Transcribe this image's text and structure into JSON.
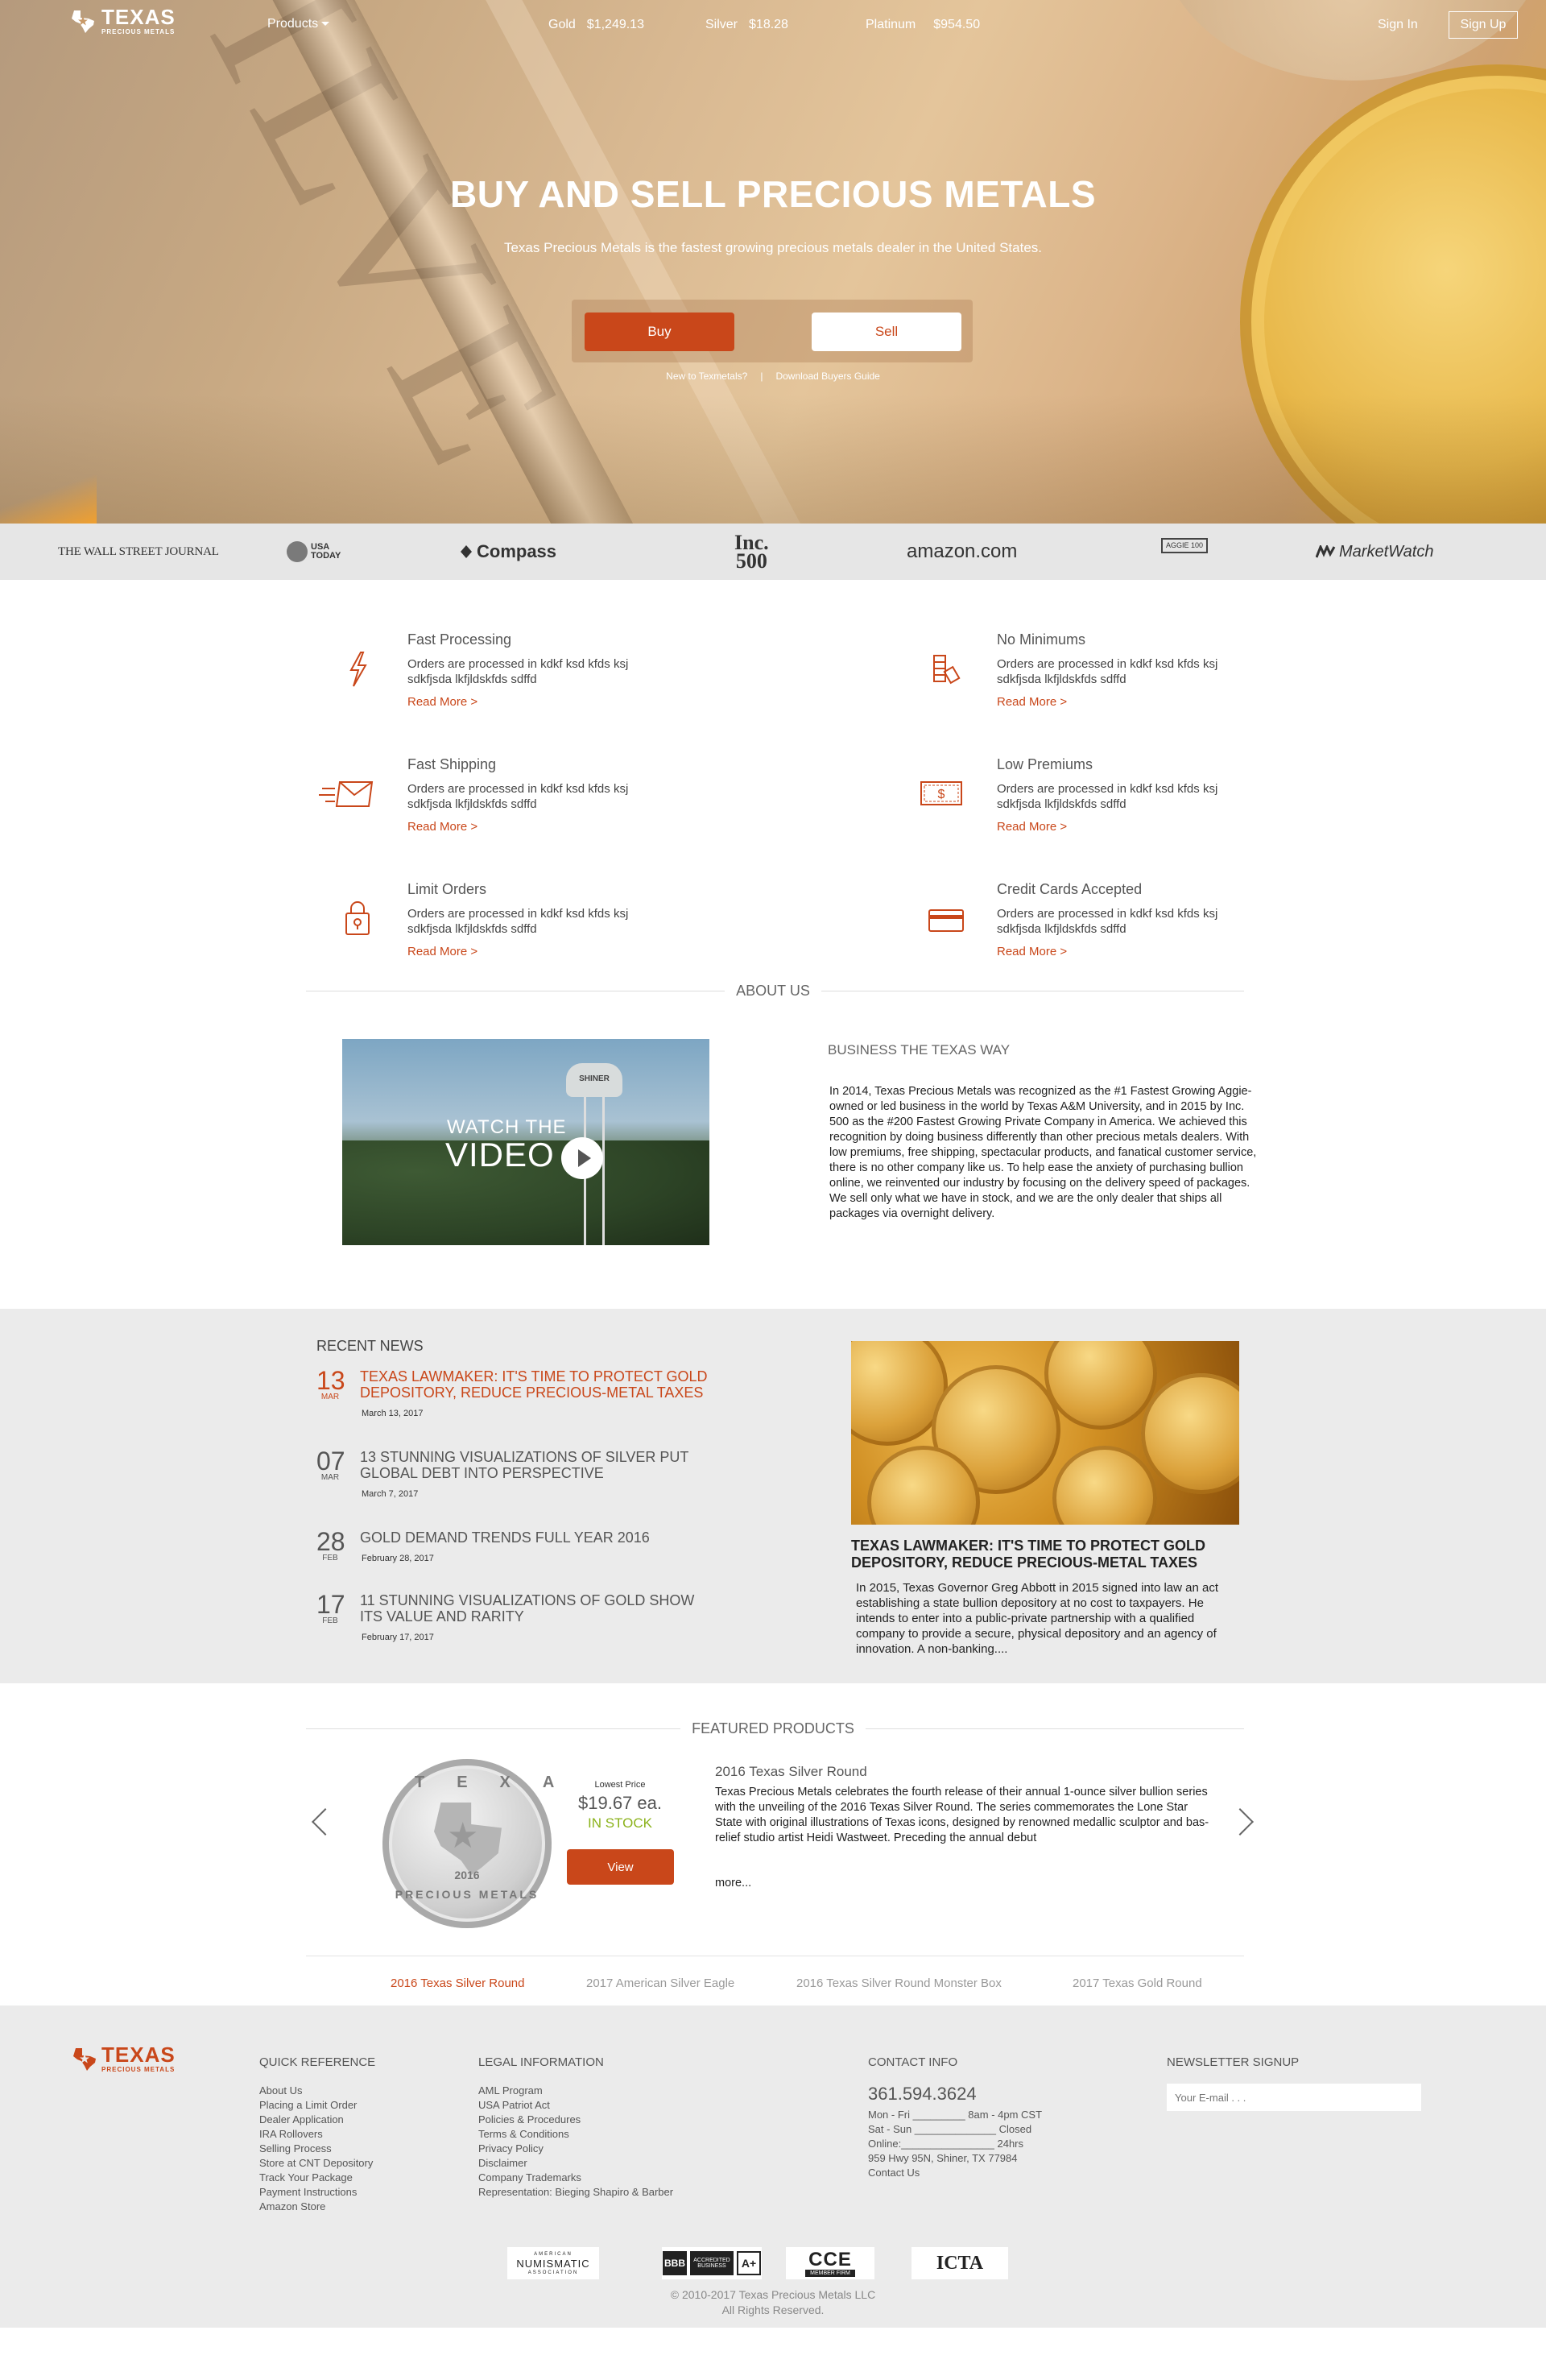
{
  "header": {
    "logo_main": "TEXAS",
    "logo_sub": "PRECIOUS METALS",
    "products_label": "Products",
    "spot_prices": [
      {
        "name": "Gold",
        "price": "$1,249.13"
      },
      {
        "name": "Silver",
        "price": "$18.28"
      },
      {
        "name": "Platinum",
        "price": "$954.50"
      }
    ],
    "sign_in": "Sign In",
    "sign_up": "Sign Up"
  },
  "hero": {
    "title": "BUY AND SELL PRECIOUS METALS",
    "subtitle": "Texas Precious Metals is the fastest growing precious metals dealer in the United States.",
    "buy_label": "Buy",
    "sell_label": "Sell",
    "link_new": "New to Texmetals?",
    "link_separator": "|",
    "link_guide": "Download Buyers Guide",
    "stamp_text": "SILVE"
  },
  "press": {
    "wsj": "THE WALL STREET JOURNAL",
    "usa_today": "USA TODAY",
    "compass": "Compass",
    "inc_top": "Inc.",
    "inc_bottom": "500",
    "amazon": "amazon.com",
    "aggie": "AGGIE 100",
    "marketwatch": "MarketWatch"
  },
  "features": [
    {
      "title": "Fast Processing",
      "text": "Orders are processed in kdkf ksd kfds ksj sdkfjsda lkfjldskfds sdffd",
      "link": "Read More >",
      "icon": "lightning-icon"
    },
    {
      "title": "No Minimums",
      "text": "Orders are processed in kdkf ksd kfds ksj sdkfjsda lkfjldskfds sdffd",
      "link": "Read More >",
      "icon": "bars-stack-icon"
    },
    {
      "title": "Fast Shipping",
      "text": "Orders are processed in kdkf ksd kfds ksj sdkfjsda lkfjldskfds sdffd",
      "link": "Read More >",
      "icon": "envelope-icon"
    },
    {
      "title": "Low Premiums",
      "text": "Orders are processed in kdkf ksd kfds ksj sdkfjsda lkfjldskfds sdffd",
      "link": "Read More >",
      "icon": "dollar-bill-icon"
    },
    {
      "title": "Limit Orders",
      "text": "Orders are processed in kdkf ksd kfds ksj sdkfjsda lkfjldskfds sdffd",
      "link": "Read More >",
      "icon": "lock-icon"
    },
    {
      "title": "Credit Cards Accepted",
      "text": "Orders are processed in kdkf ksd kfds ksj sdkfjsda lkfjldskfds sdffd",
      "link": "Read More >",
      "icon": "credit-card-icon"
    }
  ],
  "about": {
    "heading": "ABOUT US",
    "video_line1": "WATCH THE",
    "video_line2": "VIDEO",
    "video_tower_text": "SHINER",
    "title": "BUSINESS THE TEXAS WAY",
    "body": "In 2014, Texas Precious Metals was recognized as the #1 Fastest Growing Aggie-owned or led business in the world by Texas A&M University, and in 2015 by Inc. 500 as the #200 Fastest Growing Private Company in America. We achieved this recognition by doing business differently than other precious metals dealers. With low premiums, free shipping, spectacular products, and fanatical customer service, there is no other company like us. To help ease the anxiety of purchasing bullion online, we reinvented our industry by focusing on the delivery speed of packages. We sell only what we have in stock, and we are the only dealer that ships all packages via overnight delivery."
  },
  "news": {
    "heading": "RECENT NEWS",
    "items": [
      {
        "day": "13",
        "month": "MAR",
        "title": "TEXAS LAWMAKER: IT'S TIME TO PROTECT GOLD DEPOSITORY, REDUCE PRECIOUS-METAL TAXES",
        "date": "March 13, 2017"
      },
      {
        "day": "07",
        "month": "MAR",
        "title": "13 STUNNING VISUALIZATIONS OF SILVER PUT GLOBAL DEBT INTO PERSPECTIVE",
        "date": "March 7, 2017"
      },
      {
        "day": "28",
        "month": "FEB",
        "title": "GOLD DEMAND TRENDS FULL YEAR 2016",
        "date": "February 28, 2017"
      },
      {
        "day": "17",
        "month": "FEB",
        "title": "11 STUNNING VISUALIZATIONS OF GOLD SHOW ITS VALUE AND RARITY",
        "date": "February 17, 2017"
      }
    ],
    "featured_title": "TEXAS LAWMAKER: IT'S TIME TO PROTECT GOLD DEPOSITORY, REDUCE PRECIOUS-METAL TAXES",
    "featured_body": "In 2015, Texas Governor Greg Abbott in 2015 signed into law an act establishing a state bullion depository at no cost to taxpayers. He intends to enter into a public-private partnership with a qualified company to provide a secure, physical depository and an agency of innovation. A non-banking...."
  },
  "featured_products": {
    "heading": "FEATURED PRODUCTS",
    "lowest_price_label": "Lowest Price",
    "price": "$19.67 ea.",
    "stock": "IN STOCK",
    "view_label": "View",
    "product_title": "2016 Texas Silver Round",
    "product_desc": "Texas Precious Metals celebrates the fourth release of their annual 1-ounce silver bullion series with the unveiling of the 2016 Texas Silver Round. The series commemorates the Lone Star State with original illustrations of Texas icons, designed by renowned medallic sculptor and bas-relief studio artist Heidi Wastweet. Preceding the annual debut",
    "more_label": "more...",
    "coin_top": "TEXA",
    "coin_year": "2016",
    "coin_bottom": "PRECIOUS METALS",
    "tabs": [
      "2016 Texas Silver Round",
      "2017 American Silver Eagle",
      "2016 Texas Silver Round Monster Box",
      "2017 Texas Gold Round"
    ]
  },
  "footer": {
    "quick_reference": {
      "title": "QUICK REFERENCE",
      "links": [
        "About Us",
        "Placing a Limit Order",
        "Dealer Application",
        "IRA Rollovers",
        "Selling Process",
        "Store at CNT Depository",
        "Track Your Package",
        "Payment Instructions",
        "Amazon Store"
      ]
    },
    "legal": {
      "title": "LEGAL INFORMATION",
      "links": [
        "AML Program",
        "USA Patriot Act",
        "Policies & Procedures",
        "Terms & Conditions",
        "Privacy Policy",
        "Disclaimer",
        "Company Trademarks",
        "Representation: Bieging Shapiro & Barber"
      ]
    },
    "contact": {
      "title": "CONTACT INFO",
      "phone": "361.594.3624",
      "lines": [
        "Mon - Fri _________ 8am - 4pm CST",
        "Sat - Sun ______________ Closed",
        "Online:________________ 24hrs",
        "959 Hwy 95N, Shiner, TX 77984",
        "Contact Us"
      ]
    },
    "newsletter": {
      "title": "NEWSLETTER SIGNUP",
      "placeholder": "Your E-mail . . ."
    },
    "badges": {
      "ana_top": "AMERICAN",
      "ana_main": "NUMISMATIC",
      "ana_bottom": "ASSOCIATION",
      "bbb_text": "ACCREDITED BUSINESS",
      "bbb_rating": "A+",
      "cce": "CCE",
      "cce_sub": "MEMBER FIRM",
      "icta": "ICTA"
    },
    "copyright_line1": "© 2010-2017 Texas Precious Metals LLC",
    "copyright_line2": "All Rights Reserved."
  },
  "colors": {
    "accent": "#c9471a",
    "in_stock": "#8bb21b",
    "footer_bg": "#ebebeb",
    "press_bg": "#e6e6e6"
  }
}
